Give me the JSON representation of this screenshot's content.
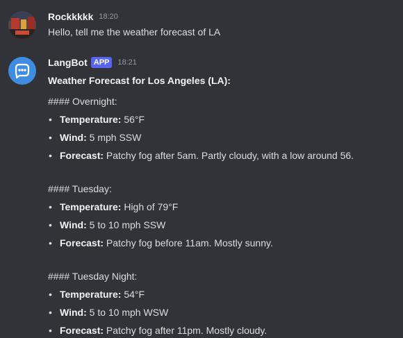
{
  "messages": [
    {
      "username": "Rockkkkk",
      "timestamp": "18:20",
      "text": "Hello, tell me the weather forecast of LA"
    },
    {
      "username": "LangBot",
      "badge": "APP",
      "timestamp": "18:21",
      "title": "Weather Forecast for Los Angeles (LA):",
      "sections": [
        {
          "heading": "#### Overnight:",
          "items": [
            {
              "key": "Temperature:",
              "value": " 56°F"
            },
            {
              "key": "Wind:",
              "value": " 5 mph SSW"
            },
            {
              "key": "Forecast:",
              "value": " Patchy fog after 5am. Partly cloudy, with a low around 56."
            }
          ]
        },
        {
          "heading": "#### Tuesday:",
          "items": [
            {
              "key": "Temperature:",
              "value": " High of 79°F"
            },
            {
              "key": "Wind:",
              "value": " 5 to 10 mph SSW"
            },
            {
              "key": "Forecast:",
              "value": " Patchy fog before 11am. Mostly sunny."
            }
          ]
        },
        {
          "heading": "#### Tuesday Night:",
          "items": [
            {
              "key": "Temperature:",
              "value": " 54°F"
            },
            {
              "key": "Wind:",
              "value": " 5 to 10 mph WSW"
            },
            {
              "key": "Forecast:",
              "value": " Patchy fog after 11pm. Mostly cloudy."
            }
          ]
        }
      ]
    }
  ],
  "bullet_char": "•",
  "colors": {
    "background": "#313338",
    "text": "#dbdee1",
    "username": "#f2f3f5",
    "timestamp": "#949ba4",
    "badge": "#5865f2",
    "bot_avatar": "#3f8de0"
  },
  "icons": {
    "user_avatar": "user-avatar-photo",
    "bot_avatar": "discord-bot-face-icon"
  }
}
